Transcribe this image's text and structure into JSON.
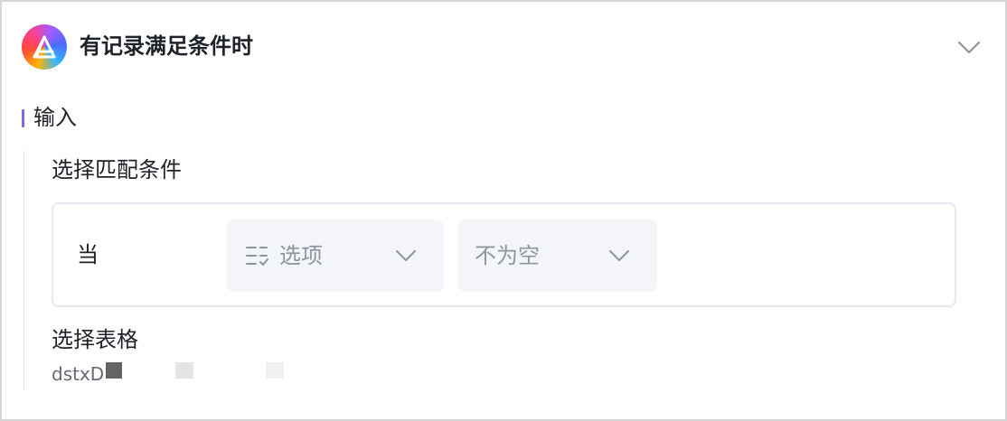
{
  "header": {
    "title": "有记录满足条件时",
    "app_icon": "automation-logo-icon",
    "collapse_icon": "chevron-down-icon"
  },
  "section": {
    "title": "输入",
    "accent_color": "#7c69ef"
  },
  "match_condition": {
    "label": "选择匹配条件",
    "when_label": "当",
    "field_select": {
      "value": "选项",
      "icon": "option-list-icon"
    },
    "operator_select": {
      "value": "不为空"
    }
  },
  "table_select": {
    "label": "选择表格",
    "value": "dstxD"
  }
}
